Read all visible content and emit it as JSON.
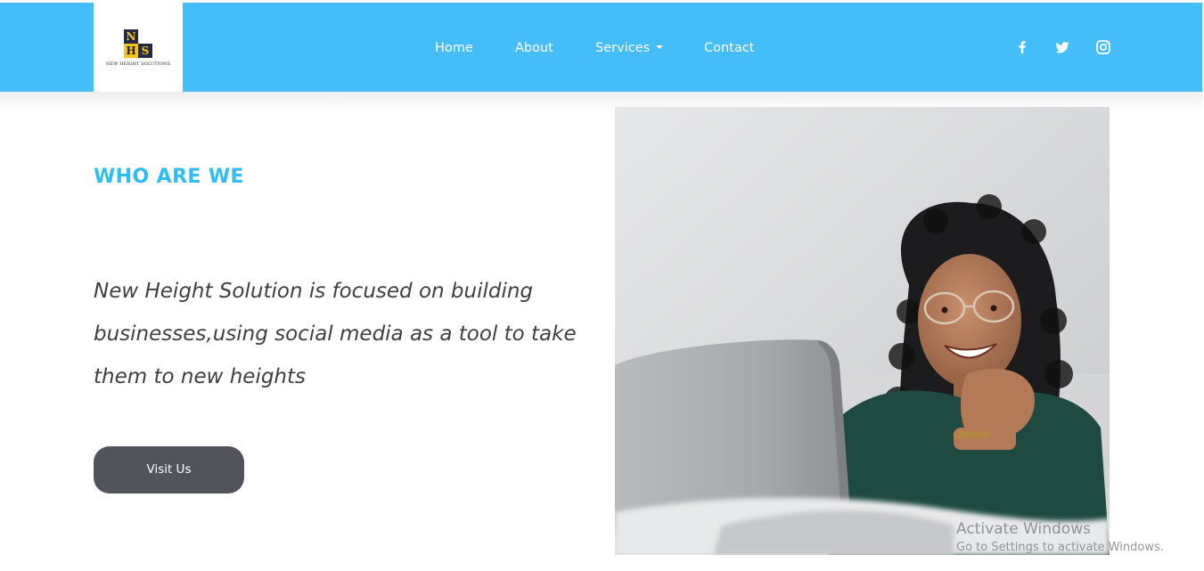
{
  "brand": {
    "logo_letters": [
      "N",
      "H",
      "S"
    ],
    "logo_caption": "NEW HEIGHT SOLUTIONS",
    "accent_color": "#44bdf8",
    "logo_yellow": "#f5c518",
    "logo_dark": "#242a45"
  },
  "nav": {
    "items": [
      {
        "label": "Home"
      },
      {
        "label": "About"
      },
      {
        "label": "Services"
      },
      {
        "label": "Contact"
      }
    ]
  },
  "social": {
    "icons": [
      "facebook-icon",
      "twitter-icon",
      "instagram-icon"
    ]
  },
  "hero": {
    "heading": "WHO ARE WE",
    "text": "New Height Solution is focused on building businesses,using social media as a tool to take them to new heights",
    "button_label": "Visit Us",
    "heading_color": "#2ebdf5",
    "button_color": "#51545a"
  },
  "image": {
    "icon": "woman-with-laptop-photo"
  },
  "watermark": {
    "title": "Activate Windows",
    "subtitle": "Go to Settings to activate Windows."
  }
}
